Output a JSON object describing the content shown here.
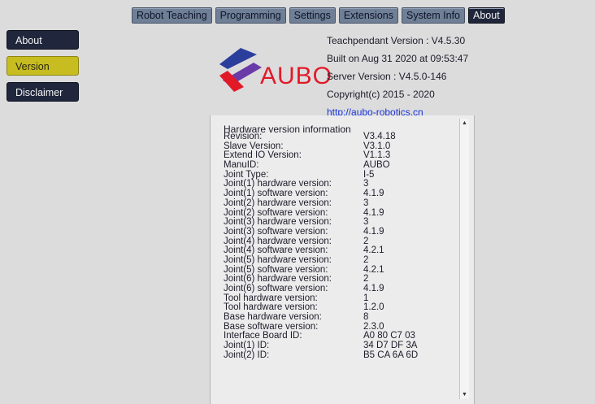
{
  "tabs": [
    {
      "label": "Robot Teaching"
    },
    {
      "label": "Programming"
    },
    {
      "label": "Settings"
    },
    {
      "label": "Extensions"
    },
    {
      "label": "System Info"
    },
    {
      "label": "About"
    }
  ],
  "sidebar": {
    "items": [
      {
        "label": "About"
      },
      {
        "label": "Version"
      },
      {
        "label": "Disclaimer"
      }
    ]
  },
  "logo": {
    "text": "AUBO"
  },
  "info": {
    "version": "Teachpendant Version : V4.5.30",
    "built": "Built on Aug 31 2020 at 09:53:47",
    "server": "Server Version : V4.5.0-146",
    "copyright": "Copyright(c) 2015 - 2020",
    "link": "http://aubo-robotics.cn"
  },
  "hardware": {
    "title": "Hardware version information",
    "rows": [
      {
        "label": "Revision:",
        "value": "V3.4.18"
      },
      {
        "label": "Slave Version:",
        "value": "V3.1.0"
      },
      {
        "label": "Extend IO Version:",
        "value": "V1.1.3"
      },
      {
        "label": "ManuID:",
        "value": "AUBO"
      },
      {
        "label": "Joint Type:",
        "value": "I-5"
      },
      {
        "label": "Joint(1) hardware version:",
        "value": "3"
      },
      {
        "label": "Joint(1) software version:",
        "value": "4.1.9"
      },
      {
        "label": "Joint(2) hardware version:",
        "value": "3"
      },
      {
        "label": "Joint(2) software version:",
        "value": "4.1.9"
      },
      {
        "label": "Joint(3) hardware version:",
        "value": "3"
      },
      {
        "label": "Joint(3) software version:",
        "value": "4.1.9"
      },
      {
        "label": "Joint(4) hardware version:",
        "value": "2"
      },
      {
        "label": "Joint(4) software version:",
        "value": "4.2.1"
      },
      {
        "label": "Joint(5) hardware version:",
        "value": "2"
      },
      {
        "label": "Joint(5) software version:",
        "value": "4.2.1"
      },
      {
        "label": "Joint(6) hardware version:",
        "value": "2"
      },
      {
        "label": "Joint(6) software version:",
        "value": "4.1.9"
      },
      {
        "label": "Tool hardware version:",
        "value": "1"
      },
      {
        "label": "Tool hardware version:",
        "value": "1.2.0"
      },
      {
        "label": "Base hardware version:",
        "value": "8"
      },
      {
        "label": "Base software version:",
        "value": "2.3.0"
      },
      {
        "label": "Interface Board ID:",
        "value": "A0 80 C7 03"
      },
      {
        "label": "Joint(1) ID:",
        "value": "34 D7 DF 3A"
      },
      {
        "label": "Joint(2) ID:",
        "value": "B5 CA 6A 6D"
      }
    ]
  },
  "colors": {
    "accent_dark": "#20263a",
    "selected_yellow": "#c8bd20",
    "logo_red": "#e21a28",
    "logo_blue": "#2c3e9c"
  }
}
